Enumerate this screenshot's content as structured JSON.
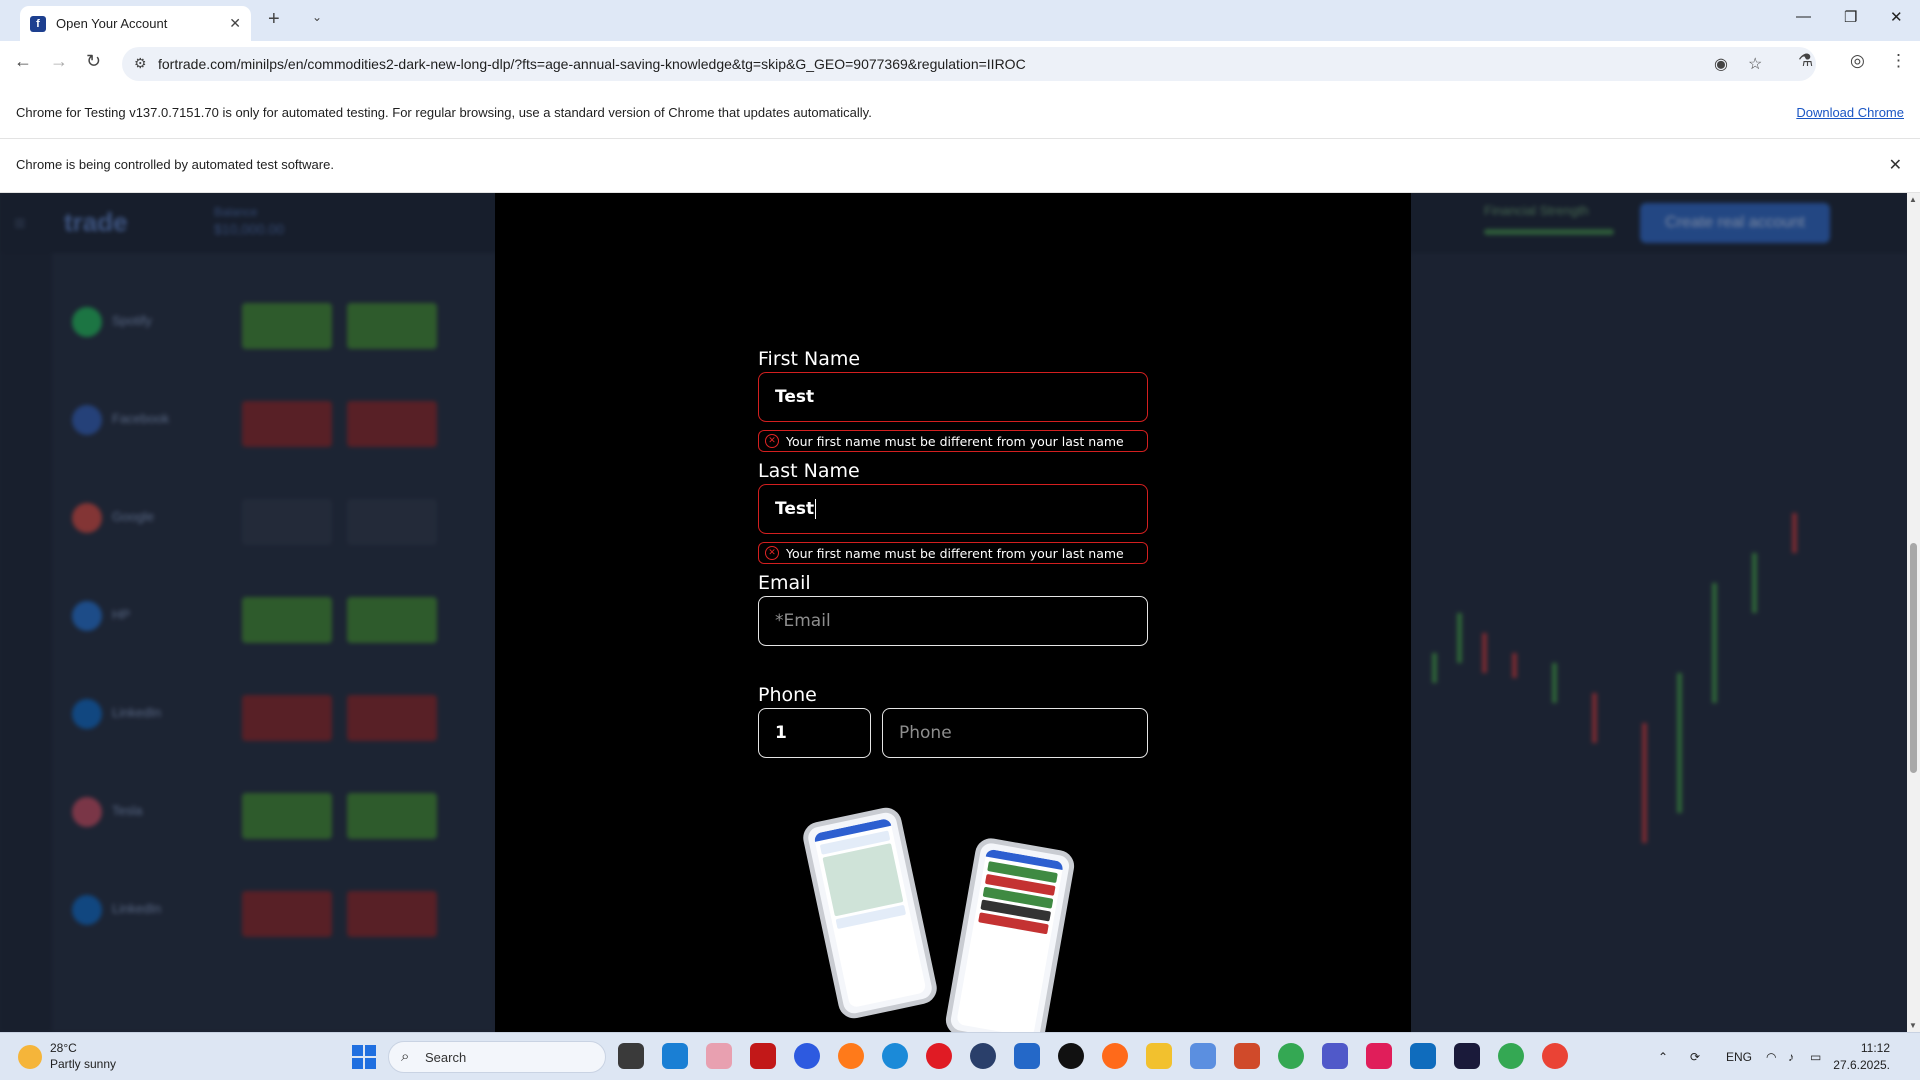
{
  "browser": {
    "tab_title": "Open Your Account",
    "tab_favicon_letter": "f",
    "url": "fortrade.com/minilps/en/commodities2-dark-new-long-dlp/?fts=age-annual-saving-knowledge&tg=skip&G_GEO=9077369&regulation=IIROC",
    "infobar_testing": "Chrome for Testing v137.0.7151.70 is only for automated testing. For regular browsing, use a standard version of Chrome that updates automatically.",
    "download_link": "Download Chrome",
    "infobar_automation": "Chrome is being controlled by automated test software."
  },
  "background": {
    "logo": "trade",
    "balance_label": "Balance",
    "balance_value": "$10,000.00",
    "cta": "Create real account",
    "strength_label": "Financial Strength",
    "instruments": [
      "Spotify",
      "Facebook",
      "Google",
      "HP",
      "LinkedIn",
      "Tesla",
      "LinkedIn"
    ]
  },
  "form": {
    "first_name": {
      "label": "First Name",
      "value": "Test",
      "error": "Your first name must be different from your last name"
    },
    "last_name": {
      "label": "Last Name",
      "value": "Test",
      "error": "Your first name must be different from your last name"
    },
    "email": {
      "label": "Email",
      "placeholder": "*Email"
    },
    "phone": {
      "label": "Phone",
      "country_code": "1",
      "placeholder": "Phone"
    }
  },
  "taskbar": {
    "weather_temp": "28°C",
    "weather_desc": "Partly sunny",
    "search_label": "Search",
    "language": "ENG",
    "time": "11:12",
    "date": "27.6.2025."
  },
  "colors": {
    "accent": "#2a66c8",
    "error": "#d31f1f",
    "modal_bg": "#000000"
  }
}
